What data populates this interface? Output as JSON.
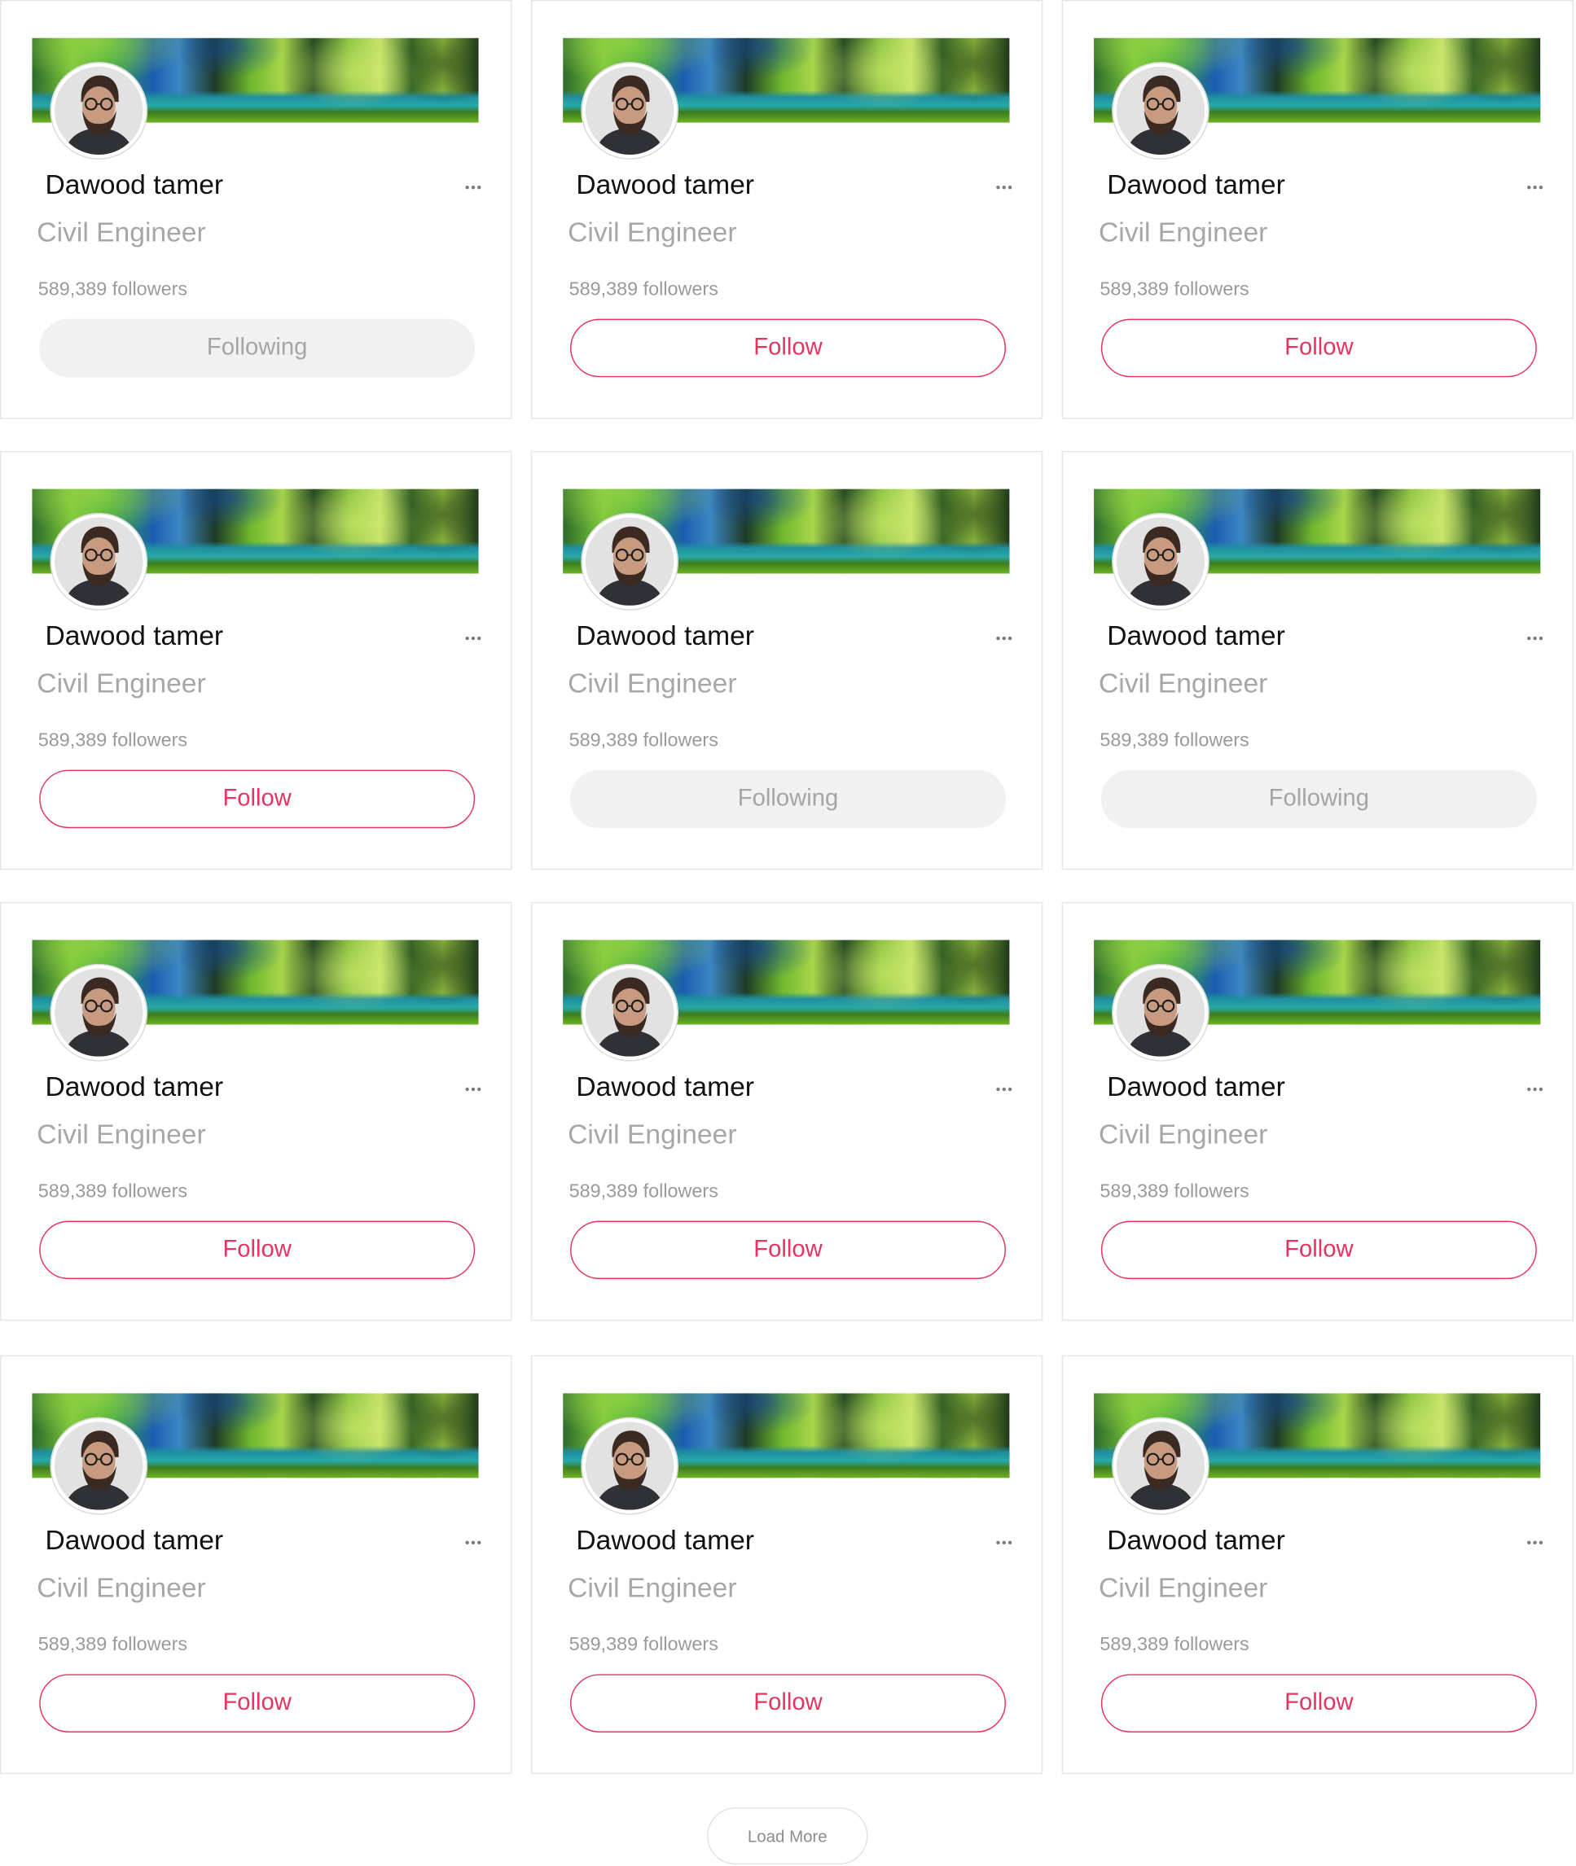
{
  "cards": [
    {
      "name": "Dawood tamer",
      "job": "Civil Engineer",
      "followers": "589,389 followers",
      "button_label": "Following",
      "state": "following"
    },
    {
      "name": "Dawood tamer",
      "job": "Civil Engineer",
      "followers": "589,389 followers",
      "button_label": "Follow",
      "state": "follow"
    },
    {
      "name": "Dawood tamer",
      "job": "Civil Engineer",
      "followers": "589,389 followers",
      "button_label": "Follow",
      "state": "follow"
    },
    {
      "name": "Dawood tamer",
      "job": "Civil Engineer",
      "followers": "589,389 followers",
      "button_label": "Follow",
      "state": "follow"
    },
    {
      "name": "Dawood tamer",
      "job": "Civil Engineer",
      "followers": "589,389 followers",
      "button_label": "Following",
      "state": "following"
    },
    {
      "name": "Dawood tamer",
      "job": "Civil Engineer",
      "followers": "589,389 followers",
      "button_label": "Following",
      "state": "following"
    },
    {
      "name": "Dawood tamer",
      "job": "Civil Engineer",
      "followers": "589,389 followers",
      "button_label": "Follow",
      "state": "follow"
    },
    {
      "name": "Dawood tamer",
      "job": "Civil Engineer",
      "followers": "589,389 followers",
      "button_label": "Follow",
      "state": "follow"
    },
    {
      "name": "Dawood tamer",
      "job": "Civil Engineer",
      "followers": "589,389 followers",
      "button_label": "Follow",
      "state": "follow"
    },
    {
      "name": "Dawood tamer",
      "job": "Civil Engineer",
      "followers": "589,389 followers",
      "button_label": "Follow",
      "state": "follow"
    },
    {
      "name": "Dawood tamer",
      "job": "Civil Engineer",
      "followers": "589,389 followers",
      "button_label": "Follow",
      "state": "follow"
    },
    {
      "name": "Dawood tamer",
      "job": "Civil Engineer",
      "followers": "589,389 followers",
      "button_label": "Follow",
      "state": "follow"
    }
  ],
  "more_icon": "more-horizontal-icon",
  "load_more_label": "Load More",
  "colors": {
    "accent": "#e3355f",
    "following_bg": "#f1f1f1",
    "muted_text": "#a7a7a7",
    "card_border": "#e6e6e6"
  }
}
